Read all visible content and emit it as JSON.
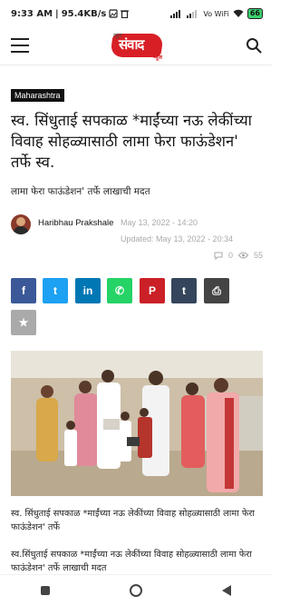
{
  "status": {
    "time": "9:33 AM",
    "speed": "95.4KB/s",
    "network": "Vo WiFi",
    "battery": "66"
  },
  "header": {
    "logo_text": "संवाद",
    "logo_pre": "न्यूज",
    "logo_tag": "न्यूज"
  },
  "article": {
    "category": "Maharashtra",
    "title": "स्व. सिंधुताई सपकाळ *माईंच्या नऊ लेकींच्या विवाह सोहळ्यासाठी लामा फेरा फाऊंडेशन' तर्फे स्व.",
    "subtitle": "लामा फेरा फाऊंडेशन' तर्फे  लाखाची मदत",
    "author": "Haribhau Prakshale",
    "date": "May 13, 2022 - 14:20",
    "updated": "Updated: May 13, 2022 - 20:34",
    "comments": "0",
    "views": "55",
    "caption": "स्व. सिंधुताई सपकाळ *माईंच्या नऊ लेकींच्या विवाह सोहळ्यासाठी लामा फेरा फाऊंडेशन' तर्फे",
    "paragraph": "स्व.सिंधुताई सपकाळ *माईंच्या नऊ लेकींच्या विवाह सोहळ्यासाठी लामा फेरा फाऊंडेशन' तर्फे  लाखाची मदत"
  },
  "share": {
    "facebook": {
      "glyph": "f",
      "color": "#3b5998"
    },
    "twitter": {
      "glyph": "t",
      "color": "#1da1f2"
    },
    "linkedin": {
      "glyph": "in",
      "color": "#0077b5"
    },
    "whatsapp": {
      "glyph": "✆",
      "color": "#25d366"
    },
    "pinterest": {
      "glyph": "P",
      "color": "#cb2027"
    },
    "tumblr": {
      "glyph": "t",
      "color": "#35465c"
    },
    "print": {
      "glyph": "⎙",
      "color": "#444444"
    },
    "favorite": {
      "glyph": "★",
      "color": "#aaaaaa"
    }
  }
}
